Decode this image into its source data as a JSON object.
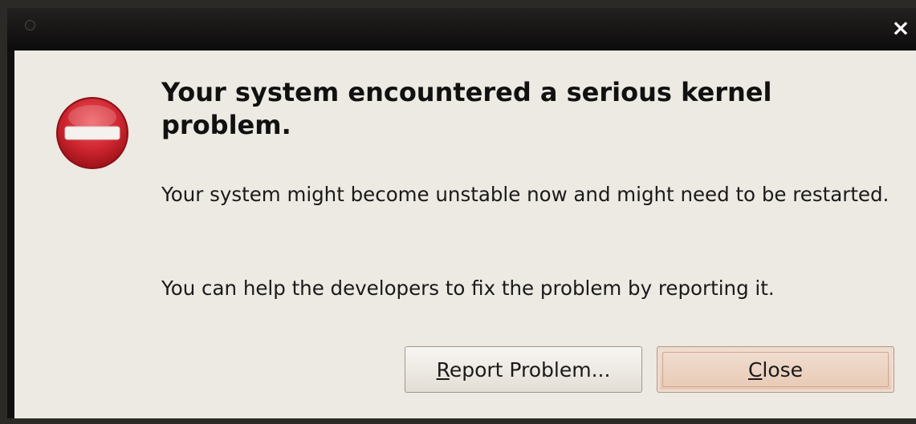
{
  "window": {
    "close_glyph": "×"
  },
  "dialog": {
    "title": "Your system encountered a serious kernel problem.",
    "message_1": "Your system might become unstable now and might need to be restarted.",
    "message_2": "You can help the developers to fix the problem by reporting it.",
    "icon": "error-stop-icon",
    "icon_color": "#c8232c"
  },
  "buttons": {
    "report": {
      "mnemonic": "R",
      "rest": "eport Problem..."
    },
    "close": {
      "mnemonic": "C",
      "rest": "lose"
    }
  }
}
